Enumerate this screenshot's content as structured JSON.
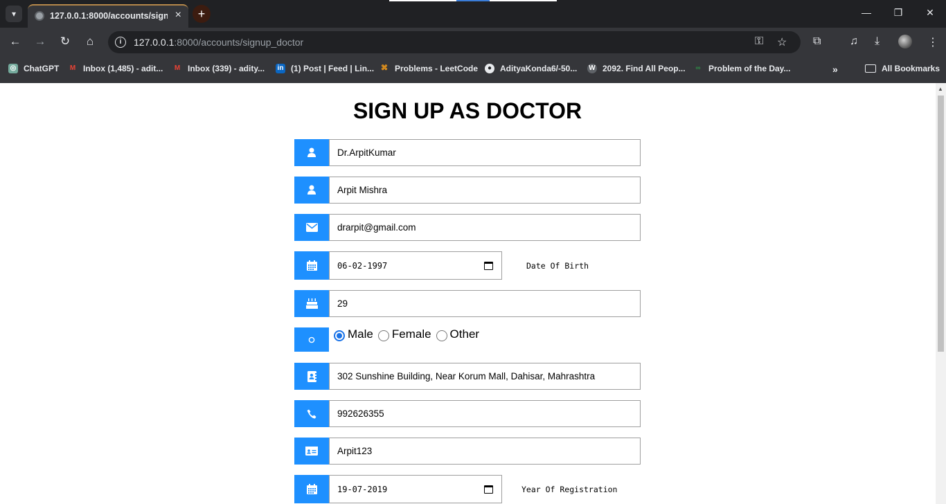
{
  "browser": {
    "tab_title": "127.0.0.1:8000/accounts/signup_doctor",
    "url_host": "127.0.0.1",
    "url_rest": ":8000/accounts/signup_doctor",
    "accent": "#1e90ff",
    "bookmarks": [
      {
        "label": "ChatGPT",
        "icon": "chatgpt-icon"
      },
      {
        "label": "Inbox (1,485) - adit...",
        "icon": "gmail-icon"
      },
      {
        "label": "Inbox (339) - adity...",
        "icon": "gmail-icon"
      },
      {
        "label": "(1) Post | Feed | Lin...",
        "icon": "linkedin-icon"
      },
      {
        "label": "Problems - LeetCode",
        "icon": "leetcode-icon"
      },
      {
        "label": "AdityaKonda6/-50...",
        "icon": "github-icon"
      },
      {
        "label": "2092. Find All Peop...",
        "icon": "w-icon"
      },
      {
        "label": "Problem of the Day...",
        "icon": "gfg-icon"
      }
    ],
    "all_bookmarks": "All Bookmarks"
  },
  "form": {
    "title": "SIGN UP AS DOCTOR",
    "username": "Dr.ArpitKumar",
    "full_name": "Arpit Mishra",
    "email": "drarpit@gmail.com",
    "dob": "06-02-1997",
    "dob_label": "Date Of Birth",
    "age": "29",
    "gender_options": [
      "Male",
      "Female",
      "Other"
    ],
    "gender_selected": "Male",
    "address": "302 Sunshine Building, Near Korum Mall, Dahisar, Mahrashtra",
    "phone": "992626355",
    "registration_no": "Arpit123",
    "registration_date": "19-07-2019",
    "registration_label": "Year Of Registration"
  }
}
